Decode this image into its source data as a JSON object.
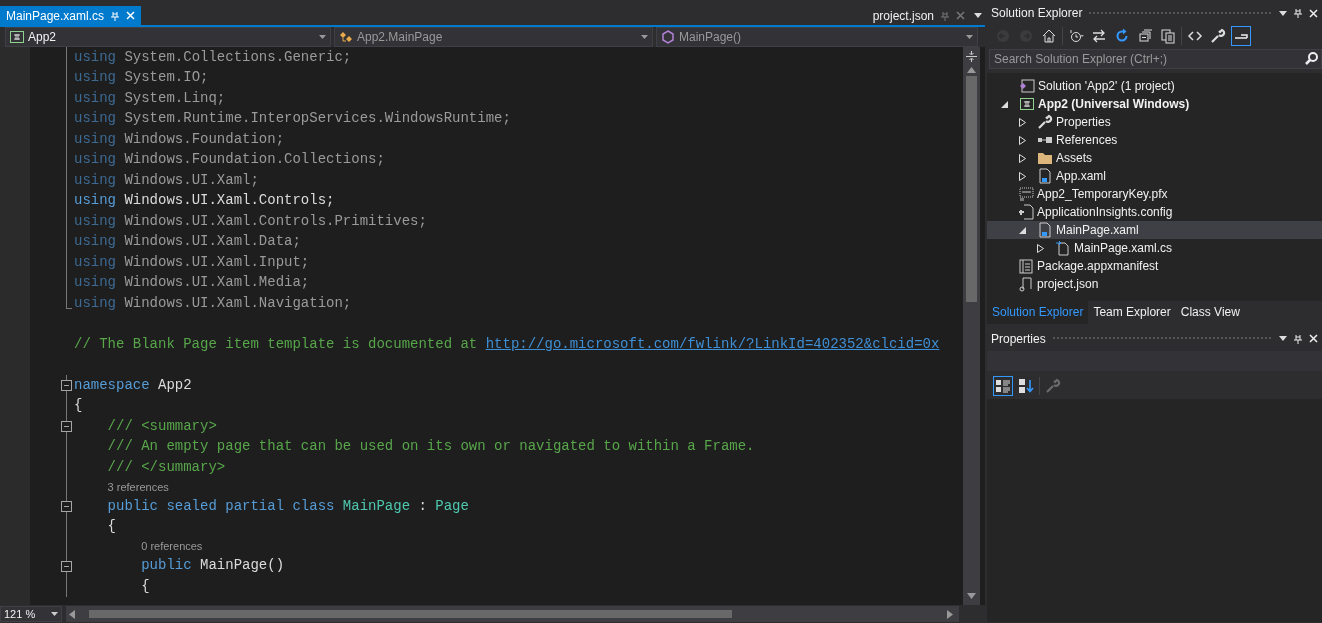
{
  "editor": {
    "tabs": [
      {
        "label": "MainPage.xaml.cs",
        "selected": true,
        "kind": "document"
      },
      {
        "label": "project.json",
        "selected": false,
        "kind": "preview"
      }
    ],
    "navigation_bar": [
      {
        "kind": "project",
        "text": "App2"
      },
      {
        "kind": "type",
        "text": "App2.MainPage"
      },
      {
        "kind": "member",
        "text": "MainPage()"
      }
    ],
    "code_sections": [
      {
        "outlined": true,
        "lines": [
          {
            "kind": "code",
            "collapsible": false,
            "dim": true,
            "tokens": [
              {
                "kind": "keyword",
                "text": "using"
              },
              {
                "kind": "plain",
                "text": " System.Collections.Generic;"
              }
            ]
          },
          {
            "kind": "code",
            "collapsible": false,
            "dim": true,
            "tokens": [
              {
                "kind": "keyword",
                "text": "using"
              },
              {
                "kind": "plain",
                "text": " System.IO;"
              }
            ]
          },
          {
            "kind": "code",
            "collapsible": false,
            "dim": true,
            "tokens": [
              {
                "kind": "keyword",
                "text": "using"
              },
              {
                "kind": "plain",
                "text": " System.Linq;"
              }
            ]
          },
          {
            "kind": "code",
            "collapsible": false,
            "dim": true,
            "tokens": [
              {
                "kind": "keyword",
                "text": "using"
              },
              {
                "kind": "plain",
                "text": " System.Runtime.InteropServices.WindowsRuntime;"
              }
            ]
          },
          {
            "kind": "code",
            "collapsible": false,
            "dim": true,
            "tokens": [
              {
                "kind": "keyword",
                "text": "using"
              },
              {
                "kind": "plain",
                "text": " Windows.Foundation;"
              }
            ]
          },
          {
            "kind": "code",
            "collapsible": false,
            "dim": true,
            "tokens": [
              {
                "kind": "keyword",
                "text": "using"
              },
              {
                "kind": "plain",
                "text": " Windows.Foundation.Collections;"
              }
            ]
          },
          {
            "kind": "code",
            "collapsible": false,
            "dim": true,
            "tokens": [
              {
                "kind": "keyword",
                "text": "using"
              },
              {
                "kind": "plain",
                "text": " Windows.UI.Xaml;"
              }
            ]
          },
          {
            "kind": "code",
            "collapsible": false,
            "dim": false,
            "tokens": [
              {
                "kind": "keyword",
                "text": "using"
              },
              {
                "kind": "plain",
                "text": " Windows.UI.Xaml.Controls;"
              }
            ]
          },
          {
            "kind": "code",
            "collapsible": false,
            "dim": true,
            "tokens": [
              {
                "kind": "keyword",
                "text": "using"
              },
              {
                "kind": "plain",
                "text": " Windows.UI.Xaml.Controls.Primitives;"
              }
            ]
          },
          {
            "kind": "code",
            "collapsible": false,
            "dim": true,
            "tokens": [
              {
                "kind": "keyword",
                "text": "using"
              },
              {
                "kind": "plain",
                "text": " Windows.UI.Xaml.Data;"
              }
            ]
          },
          {
            "kind": "code",
            "collapsible": false,
            "dim": true,
            "tokens": [
              {
                "kind": "keyword",
                "text": "using"
              },
              {
                "kind": "plain",
                "text": " Windows.UI.Xaml.Input;"
              }
            ]
          },
          {
            "kind": "code",
            "collapsible": false,
            "dim": true,
            "tokens": [
              {
                "kind": "keyword",
                "text": "using"
              },
              {
                "kind": "plain",
                "text": " Windows.UI.Xaml.Media;"
              }
            ]
          },
          {
            "kind": "code",
            "collapsible": false,
            "dim": true,
            "tokens": [
              {
                "kind": "keyword",
                "text": "using"
              },
              {
                "kind": "plain",
                "text": " Windows.UI.Xaml.Navigation;"
              }
            ]
          }
        ]
      },
      {
        "outlined": false,
        "lines": [
          {
            "kind": "blank"
          },
          {
            "kind": "code",
            "collapsible": false,
            "dim": false,
            "tokens": [
              {
                "kind": "comment",
                "text": "// The Blank Page item template is documented at "
              },
              {
                "kind": "link",
                "text": "http://go.microsoft.com/fwlink/?LinkId=402352&clcid=0x"
              }
            ]
          },
          {
            "kind": "blank"
          }
        ]
      },
      {
        "outlined": true,
        "lines": [
          {
            "kind": "code",
            "collapsible": true,
            "dim": false,
            "tokens": [
              {
                "kind": "keyword",
                "text": "namespace"
              },
              {
                "kind": "plain",
                "text": " App2"
              }
            ]
          },
          {
            "kind": "code",
            "collapsible": false,
            "dim": false,
            "tokens": [
              {
                "kind": "plain",
                "text": "{"
              }
            ]
          },
          {
            "kind": "code",
            "collapsible": true,
            "dim": false,
            "tokens": [
              {
                "kind": "comment",
                "text": "    /// <summary>"
              }
            ]
          },
          {
            "kind": "code",
            "collapsible": false,
            "dim": false,
            "tokens": [
              {
                "kind": "comment",
                "text": "    /// An empty page that can be used on its own or navigated to within a Frame."
              }
            ]
          },
          {
            "kind": "code",
            "collapsible": false,
            "dim": false,
            "tokens": [
              {
                "kind": "comment",
                "text": "    /// </summary>"
              }
            ]
          },
          {
            "kind": "lens",
            "text": "    3 references"
          },
          {
            "kind": "code",
            "collapsible": true,
            "dim": false,
            "tokens": [
              {
                "kind": "keyword",
                "text": "    public sealed partial class "
              },
              {
                "kind": "type",
                "text": "MainPage"
              },
              {
                "kind": "plain",
                "text": " : "
              },
              {
                "kind": "type",
                "text": "Page"
              }
            ]
          },
          {
            "kind": "code",
            "collapsible": false,
            "dim": false,
            "tokens": [
              {
                "kind": "plain",
                "text": "    {"
              }
            ]
          },
          {
            "kind": "lens",
            "text": "        0 references"
          },
          {
            "kind": "code",
            "collapsible": true,
            "dim": false,
            "tokens": [
              {
                "kind": "keyword",
                "text": "        public"
              },
              {
                "kind": "plain",
                "text": " MainPage()"
              }
            ]
          },
          {
            "kind": "code",
            "collapsible": false,
            "dim": false,
            "tokens": [
              {
                "kind": "plain",
                "text": "        {"
              }
            ]
          }
        ]
      }
    ],
    "zoom": "121 %"
  },
  "solution_explorer": {
    "title": "Solution Explorer",
    "toolbar": [
      {
        "kind": "back",
        "disabled": true,
        "on": false
      },
      {
        "kind": "forward",
        "disabled": true,
        "on": false
      },
      {
        "kind": "home",
        "disabled": false,
        "on": false
      },
      {
        "kind": "separator"
      },
      {
        "kind": "history",
        "disabled": false,
        "on": false
      },
      {
        "kind": "sync",
        "disabled": false,
        "on": false
      },
      {
        "kind": "refresh",
        "disabled": false,
        "on": false
      },
      {
        "kind": "collapse",
        "disabled": false,
        "on": false
      },
      {
        "kind": "copy",
        "disabled": false,
        "on": false
      },
      {
        "kind": "separator"
      },
      {
        "kind": "code",
        "disabled": false,
        "on": false
      },
      {
        "kind": "wrench",
        "disabled": false,
        "on": false
      },
      {
        "kind": "preview",
        "disabled": false,
        "on": true
      }
    ],
    "search": {
      "placeholder": "Search Solution Explorer (Ctrl+;)"
    },
    "tree": [
      {
        "label": "Solution 'App2' (1 project)",
        "kind": "solution",
        "selected": false,
        "children": [
          {
            "label": "App2 (Universal Windows)",
            "kind": "project",
            "selected": false,
            "expanded": true,
            "children": [
              {
                "label": "Properties",
                "kind": "wrench",
                "selected": false,
                "expanded": false
              },
              {
                "label": "References",
                "kind": "references",
                "selected": false,
                "expanded": false
              },
              {
                "label": "Assets",
                "kind": "folder",
                "selected": false,
                "expanded": false
              },
              {
                "label": "App.xaml",
                "kind": "xaml",
                "selected": false,
                "expanded": false
              },
              {
                "label": "App2_TemporaryKey.pfx",
                "kind": "certificate",
                "selected": false
              },
              {
                "label": "ApplicationInsights.config",
                "kind": "config",
                "selected": false
              },
              {
                "label": "MainPage.xaml",
                "kind": "xaml",
                "selected": true,
                "expanded": true,
                "children": [
                  {
                    "label": "MainPage.xaml.cs",
                    "kind": "csfile",
                    "selected": false,
                    "expanded": false
                  }
                ]
              },
              {
                "label": "Package.appxmanifest",
                "kind": "manifest",
                "selected": false
              },
              {
                "label": "project.json",
                "kind": "json",
                "selected": false
              }
            ]
          }
        ]
      }
    ]
  },
  "panel_tabs": [
    {
      "label": "Solution Explorer",
      "selected": true
    },
    {
      "label": "Team Explorer",
      "selected": false
    },
    {
      "label": "Class View",
      "selected": false
    }
  ],
  "properties": {
    "title": "Properties",
    "toolbar": [
      {
        "kind": "categorized",
        "disabled": false,
        "on": true
      },
      {
        "kind": "alphabetical",
        "disabled": false,
        "on": false
      },
      {
        "kind": "separator"
      },
      {
        "kind": "wrench",
        "disabled": true,
        "on": false
      }
    ]
  }
}
